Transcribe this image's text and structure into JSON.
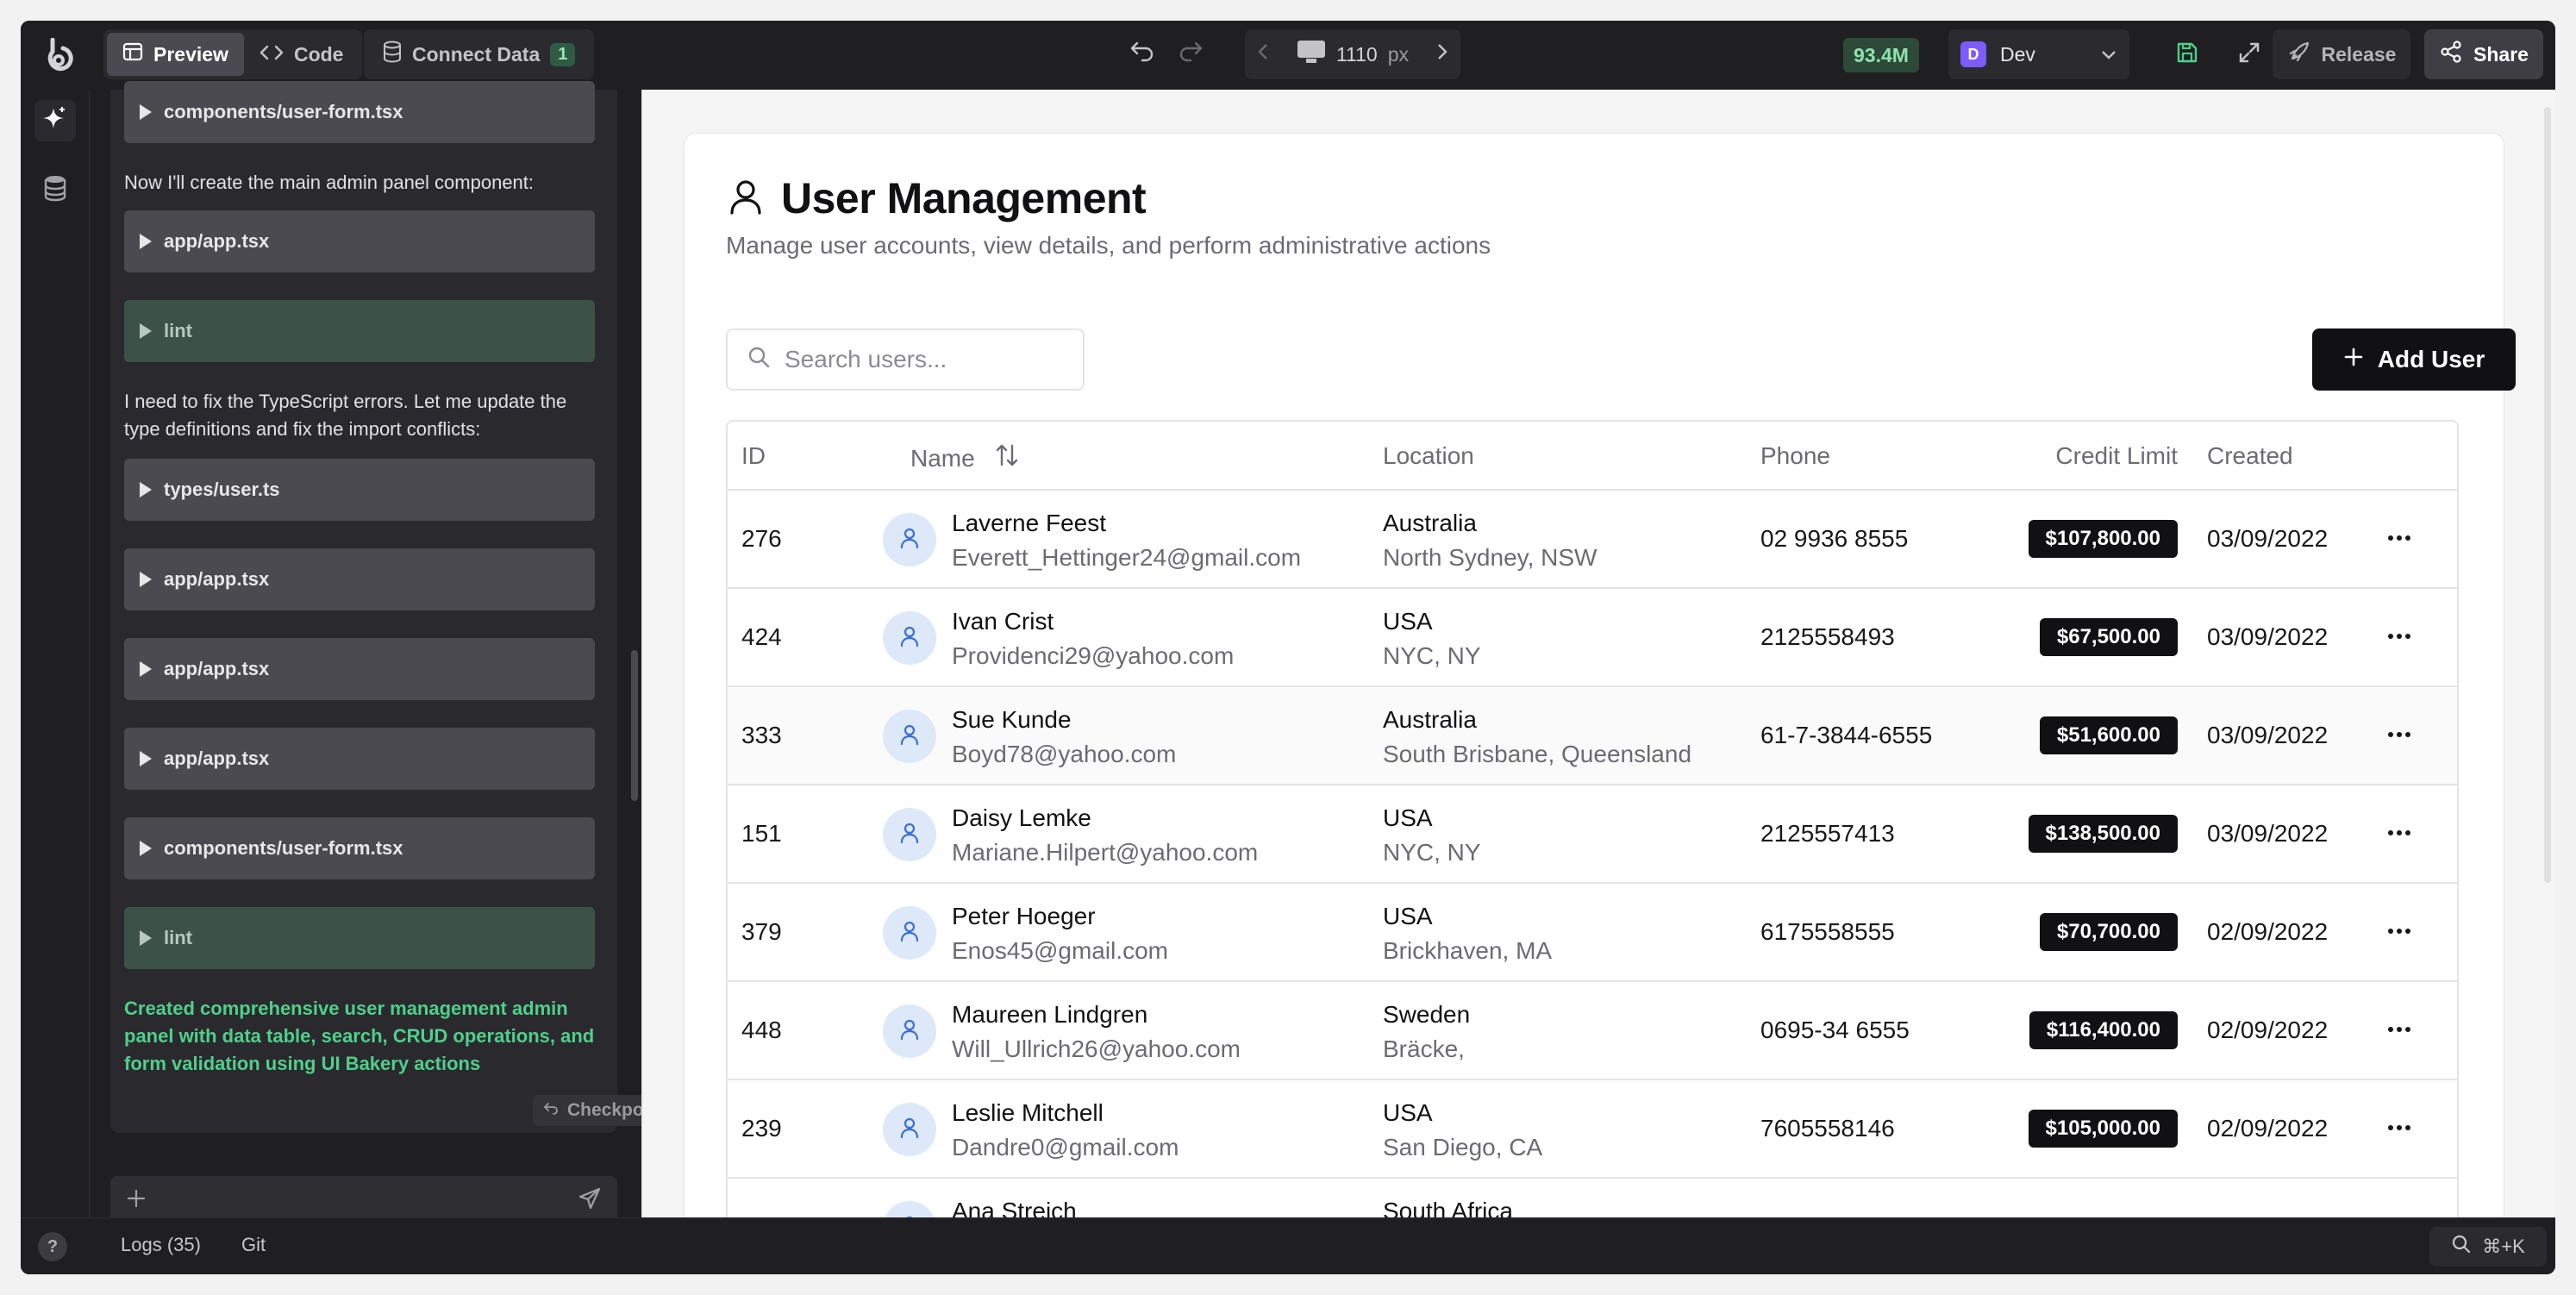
{
  "topbar": {
    "tabs": [
      {
        "label": "Preview",
        "active": true
      },
      {
        "label": "Code",
        "active": false
      }
    ],
    "connect_data": {
      "label": "Connect Data",
      "count": "1"
    },
    "viewport": {
      "width": "1110",
      "unit": "px"
    },
    "memory": "93.4M",
    "env": {
      "initial": "D",
      "name": "Dev"
    },
    "release_label": "Release",
    "share_label": "Share"
  },
  "chat": {
    "top_tool": "components/user-form.tsx",
    "msg1": "Now I'll create the main admin panel component:",
    "tool_app1": "app/app.tsx",
    "lint1": "lint",
    "msg2": "I need to fix the TypeScript errors. Let me update the type definitions and fix the import conflicts:",
    "tool_types": "types/user.ts",
    "tool_app2": "app/app.tsx",
    "tool_app3": "app/app.tsx",
    "tool_app4": "app/app.tsx",
    "tool_form": "components/user-form.tsx",
    "lint2": "lint",
    "summary": "Created comprehensive user management admin panel with data table, search, CRUD operations, and form validation using UI Bakery actions",
    "checkpoint_label": "Checkpoint"
  },
  "bottombar": {
    "help": "?",
    "logs_label": "Logs (35)",
    "git_label": "Git",
    "cmdk": "⌘+K"
  },
  "page": {
    "title": "User Management",
    "subtitle": "Manage user accounts, view details, and perform administrative actions",
    "search_placeholder": "Search users...",
    "add_user_label": "Add User"
  },
  "table": {
    "headers": {
      "id": "ID",
      "name": "Name",
      "location": "Location",
      "phone": "Phone",
      "credit": "Credit Limit",
      "created": "Created"
    },
    "rows": [
      {
        "id": "276",
        "name": "Laverne Feest",
        "email": "Everett_Hettinger24@gmail.com",
        "country": "Australia",
        "city": "North Sydney, NSW",
        "phone": "02 9936 8555",
        "credit": "$107,800.00",
        "created": "03/09/2022"
      },
      {
        "id": "424",
        "name": "Ivan Crist",
        "email": "Providenci29@yahoo.com",
        "country": "USA",
        "city": "NYC, NY",
        "phone": "2125558493",
        "credit": "$67,500.00",
        "created": "03/09/2022"
      },
      {
        "id": "333",
        "name": "Sue Kunde",
        "email": "Boyd78@yahoo.com",
        "country": "Australia",
        "city": "South Brisbane, Queensland",
        "phone": "61-7-3844-6555",
        "credit": "$51,600.00",
        "created": "03/09/2022"
      },
      {
        "id": "151",
        "name": "Daisy Lemke",
        "email": "Mariane.Hilpert@yahoo.com",
        "country": "USA",
        "city": "NYC, NY",
        "phone": "2125557413",
        "credit": "$138,500.00",
        "created": "03/09/2022"
      },
      {
        "id": "379",
        "name": "Peter Hoeger",
        "email": "Enos45@gmail.com",
        "country": "USA",
        "city": "Brickhaven, MA",
        "phone": "6175558555",
        "credit": "$70,700.00",
        "created": "02/09/2022"
      },
      {
        "id": "448",
        "name": "Maureen Lindgren",
        "email": "Will_Ullrich26@yahoo.com",
        "country": "Sweden",
        "city": "Bräcke,",
        "phone": "0695-34 6555",
        "credit": "$116,400.00",
        "created": "02/09/2022"
      },
      {
        "id": "239",
        "name": "Leslie Mitchell",
        "email": "Dandre0@gmail.com",
        "country": "USA",
        "city": "San Diego, CA",
        "phone": "7605558146",
        "credit": "$105,000.00",
        "created": "02/09/2022"
      },
      {
        "id": "",
        "name": "Ana Streich",
        "email": "",
        "country": "South Africa",
        "city": "",
        "phone": "",
        "credit": "",
        "created": ""
      }
    ]
  }
}
